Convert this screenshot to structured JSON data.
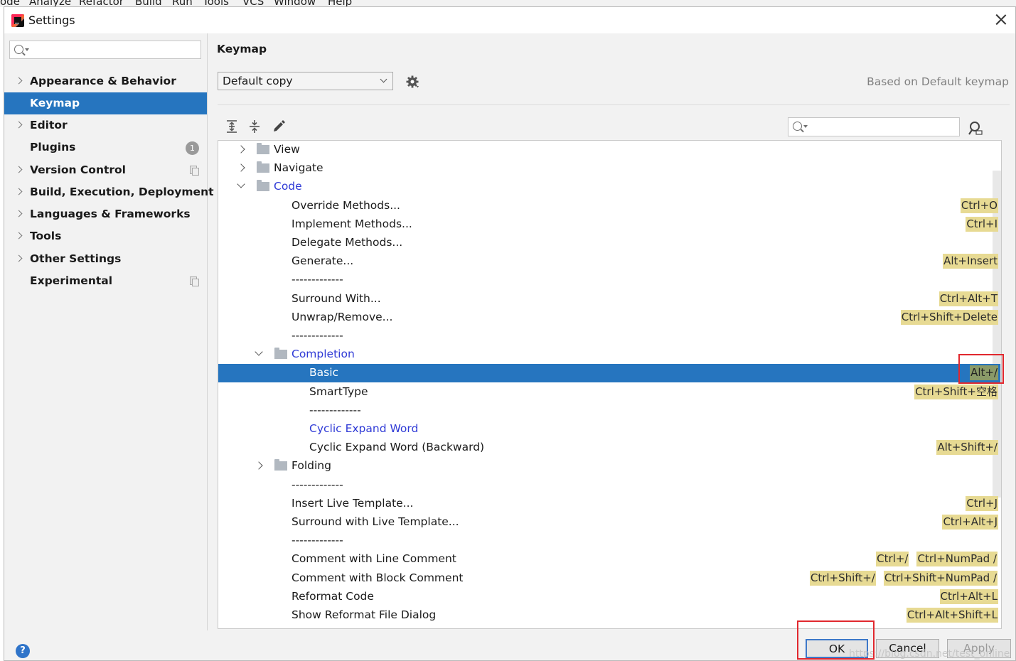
{
  "background_menu": [
    "ode",
    "Analyze",
    "Refactor",
    "Build",
    "Run",
    "Tools",
    "VCS",
    "Window",
    "Help"
  ],
  "window": {
    "title": "Settings"
  },
  "sidebar": {
    "search_placeholder": "",
    "items": [
      {
        "label": "Appearance & Behavior",
        "expandable": true
      },
      {
        "label": "Keymap",
        "selected": true
      },
      {
        "label": "Editor",
        "expandable": true
      },
      {
        "label": "Plugins",
        "badge": "1"
      },
      {
        "label": "Version Control",
        "expandable": true,
        "project_icon": true
      },
      {
        "label": "Build, Execution, Deployment",
        "expandable": true
      },
      {
        "label": "Languages & Frameworks",
        "expandable": true
      },
      {
        "label": "Tools",
        "expandable": true
      },
      {
        "label": "Other Settings",
        "expandable": true
      },
      {
        "label": "Experimental",
        "project_icon": true
      }
    ]
  },
  "keymap": {
    "title": "Keymap",
    "scheme": "Default copy",
    "based_on": "Based on Default keymap",
    "filter_placeholder": "",
    "tree": [
      {
        "label": "View",
        "indent": 0,
        "folder": true,
        "expanded": false
      },
      {
        "label": "Navigate",
        "indent": 0,
        "folder": true,
        "expanded": false
      },
      {
        "label": "Code",
        "indent": 0,
        "folder": true,
        "expanded": true,
        "blue": true
      },
      {
        "label": "Override Methods...",
        "indent": 1,
        "keys": [
          "Ctrl+O"
        ]
      },
      {
        "label": "Implement Methods...",
        "indent": 1,
        "keys": [
          "Ctrl+I"
        ]
      },
      {
        "label": "Delegate Methods...",
        "indent": 1,
        "keys": []
      },
      {
        "label": "Generate...",
        "indent": 1,
        "keys": [
          "Alt+Insert"
        ]
      },
      {
        "label": "-------------",
        "indent": 1,
        "keys": []
      },
      {
        "label": "Surround With...",
        "indent": 1,
        "keys": [
          "Ctrl+Alt+T"
        ]
      },
      {
        "label": "Unwrap/Remove...",
        "indent": 1,
        "keys": [
          "Ctrl+Shift+Delete"
        ]
      },
      {
        "label": "-------------",
        "indent": 1,
        "keys": []
      },
      {
        "label": "Completion",
        "indent": 1,
        "folder": true,
        "expanded": true,
        "blue": true
      },
      {
        "label": "Basic",
        "indent": 2,
        "keys": [
          "Alt+/"
        ],
        "selected": true
      },
      {
        "label": "SmartType",
        "indent": 2,
        "keys": [
          "Ctrl+Shift+空格"
        ]
      },
      {
        "label": "-------------",
        "indent": 2,
        "keys": []
      },
      {
        "label": "Cyclic Expand Word",
        "indent": 2,
        "keys": [],
        "blue": true
      },
      {
        "label": "Cyclic Expand Word (Backward)",
        "indent": 2,
        "keys": [
          "Alt+Shift+/"
        ]
      },
      {
        "label": "Folding",
        "indent": 1,
        "folder": true,
        "expanded": false
      },
      {
        "label": "-------------",
        "indent": 1,
        "keys": []
      },
      {
        "label": "Insert Live Template...",
        "indent": 1,
        "keys": [
          "Ctrl+J"
        ]
      },
      {
        "label": "Surround with Live Template...",
        "indent": 1,
        "keys": [
          "Ctrl+Alt+J"
        ]
      },
      {
        "label": "-------------",
        "indent": 1,
        "keys": []
      },
      {
        "label": "Comment with Line Comment",
        "indent": 1,
        "keys": [
          "Ctrl+/",
          "Ctrl+NumPad /"
        ]
      },
      {
        "label": "Comment with Block Comment",
        "indent": 1,
        "keys": [
          "Ctrl+Shift+/",
          "Ctrl+Shift+NumPad /"
        ]
      },
      {
        "label": "Reformat Code",
        "indent": 1,
        "keys": [
          "Ctrl+Alt+L"
        ]
      },
      {
        "label": "Show Reformat File Dialog",
        "indent": 1,
        "keys": [
          "Ctrl+Alt+Shift+L"
        ]
      }
    ]
  },
  "buttons": {
    "ok": "OK",
    "cancel": "Cancel",
    "apply": "Apply",
    "help": "?"
  },
  "watermark": "https://blog.csdn.net/test_online",
  "colors": {
    "selection": "#2675bf",
    "shortcut_bg": "#e7da93",
    "highlight_box": "#e1282e",
    "link_blue": "#2f3ad6"
  }
}
